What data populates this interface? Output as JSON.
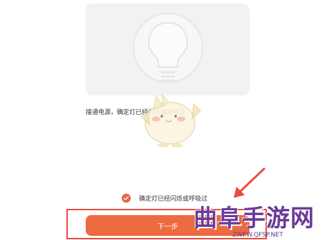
{
  "illustration": {
    "icon": "light-bulb-icon"
  },
  "instruction": {
    "text": "接通电源，确定灯已经闪烁或呼吸过"
  },
  "confirm": {
    "checked": true,
    "label": "确定灯已经闪烁或呼吸过"
  },
  "next_button": {
    "label": "下一步"
  },
  "watermark": {
    "logo_text": "曲阜手游网",
    "url": "ZWFW.QFSP.NET"
  },
  "colors": {
    "accent": "#ee6a40",
    "highlight": "#ea4a3a",
    "card": "#f2f2f2",
    "watermark": "#6b3a9a"
  }
}
